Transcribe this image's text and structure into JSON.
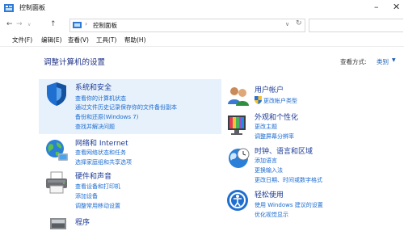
{
  "window": {
    "title": "控制面板",
    "minimize_glyph": "–",
    "close_glyph": "✕"
  },
  "addressbar": {
    "back_glyph": "←",
    "forward_glyph": "→",
    "up_glyph": "↑",
    "separator": "›",
    "path": "控制面板",
    "dropdown_glyph": "∨",
    "refresh_glyph": "↻"
  },
  "menu": {
    "items": [
      "文件(F)",
      "编辑(E)",
      "查看(V)",
      "工具(T)",
      "帮助(H)"
    ]
  },
  "header": {
    "title": "调整计算机的设置",
    "view_by_label": "查看方式:",
    "view_by_value": "类别",
    "view_by_arrow": "▼"
  },
  "categories": [
    {
      "title": "系统和安全",
      "icon": "shield-icon",
      "links": [
        "查看你的计算机状态",
        "通过文件历史记录保存你的文件备份副本",
        "备份和还原(Windows 7)",
        "查找并解决问题"
      ]
    },
    {
      "title": "网络和 Internet",
      "icon": "network-globe-icon",
      "links": [
        "查看网络状态和任务",
        "选择家庭组和共享选项"
      ]
    },
    {
      "title": "硬件和声音",
      "icon": "printer-icon",
      "links": [
        "查看设备和打印机",
        "添加设备",
        "调整常用移动设置"
      ]
    },
    {
      "title": "程序",
      "icon": "programs-icon",
      "links": []
    },
    {
      "title": "用户帐户",
      "icon": "users-icon",
      "links": [
        "更改帐户类型"
      ]
    },
    {
      "title": "外观和个性化",
      "icon": "appearance-icon",
      "links": [
        "更改主题",
        "调整屏幕分辨率"
      ]
    },
    {
      "title": "时钟、语言和区域",
      "icon": "clock-globe-icon",
      "links": [
        "添加语言",
        "更换输入法",
        "更改日期、时间或数字格式"
      ]
    },
    {
      "title": "轻松使用",
      "icon": "ease-of-access-icon",
      "links": [
        "使用 Windows 建议的设置",
        "优化视觉显示"
      ]
    }
  ],
  "colors": {
    "category_title": "#1e3c96",
    "link": "#1a6bd0",
    "page_title": "#1e3287",
    "hover_panel": "#e7f1fb"
  }
}
